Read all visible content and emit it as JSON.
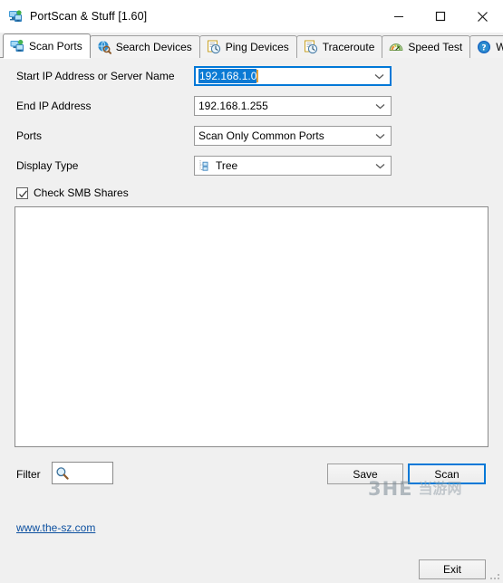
{
  "window": {
    "title": "PortScan & Stuff [1.60]",
    "icon": "portscan-app-icon",
    "controls": {
      "minimize": "minimize-icon",
      "maximize": "maximize-icon",
      "close": "close-icon"
    }
  },
  "tabs": {
    "items": [
      {
        "label": "Scan Ports",
        "icon": "scan-ports-icon",
        "active": true
      },
      {
        "label": "Search Devices",
        "icon": "search-devices-icon",
        "active": false
      },
      {
        "label": "Ping Devices",
        "icon": "ping-devices-icon",
        "active": false
      },
      {
        "label": "Traceroute",
        "icon": "traceroute-icon",
        "active": false
      },
      {
        "label": "Speed Test",
        "icon": "speed-test-icon",
        "active": false
      },
      {
        "label": "W",
        "icon": "help-icon",
        "active": false
      }
    ],
    "scroll_left": "scroll-left-arrow",
    "scroll_right": "scroll-right-arrow"
  },
  "form": {
    "start_ip": {
      "label": "Start IP Address or Server Name",
      "value": "192.168.1.0",
      "selected": true,
      "focused": true
    },
    "end_ip": {
      "label": "End IP Address",
      "value": "192.168.1.255"
    },
    "ports": {
      "label": "Ports",
      "value": "Scan Only Common Ports"
    },
    "display_type": {
      "label": "Display Type",
      "value": "Tree",
      "icon": "tree-view-icon"
    },
    "smb": {
      "label": "Check SMB Shares",
      "checked": true
    }
  },
  "results": {
    "content": ""
  },
  "bottom": {
    "filter_label": "Filter",
    "filter_value": "",
    "filter_icon": "magnifier-icon",
    "save_label": "Save",
    "scan_label": "Scan"
  },
  "footer": {
    "website": "www.the-sz.com",
    "exit_label": "Exit"
  },
  "watermark": {
    "latin": "3HE",
    "cjk": "当游网"
  },
  "colors": {
    "accent": "#0078d7",
    "selection": "#0b7ad4",
    "caret": "#e8a33d",
    "link": "#0d50a0",
    "dialog_bg": "#f0f0f0",
    "field_bg": "#ffffff",
    "border": "#9a9a9a"
  }
}
